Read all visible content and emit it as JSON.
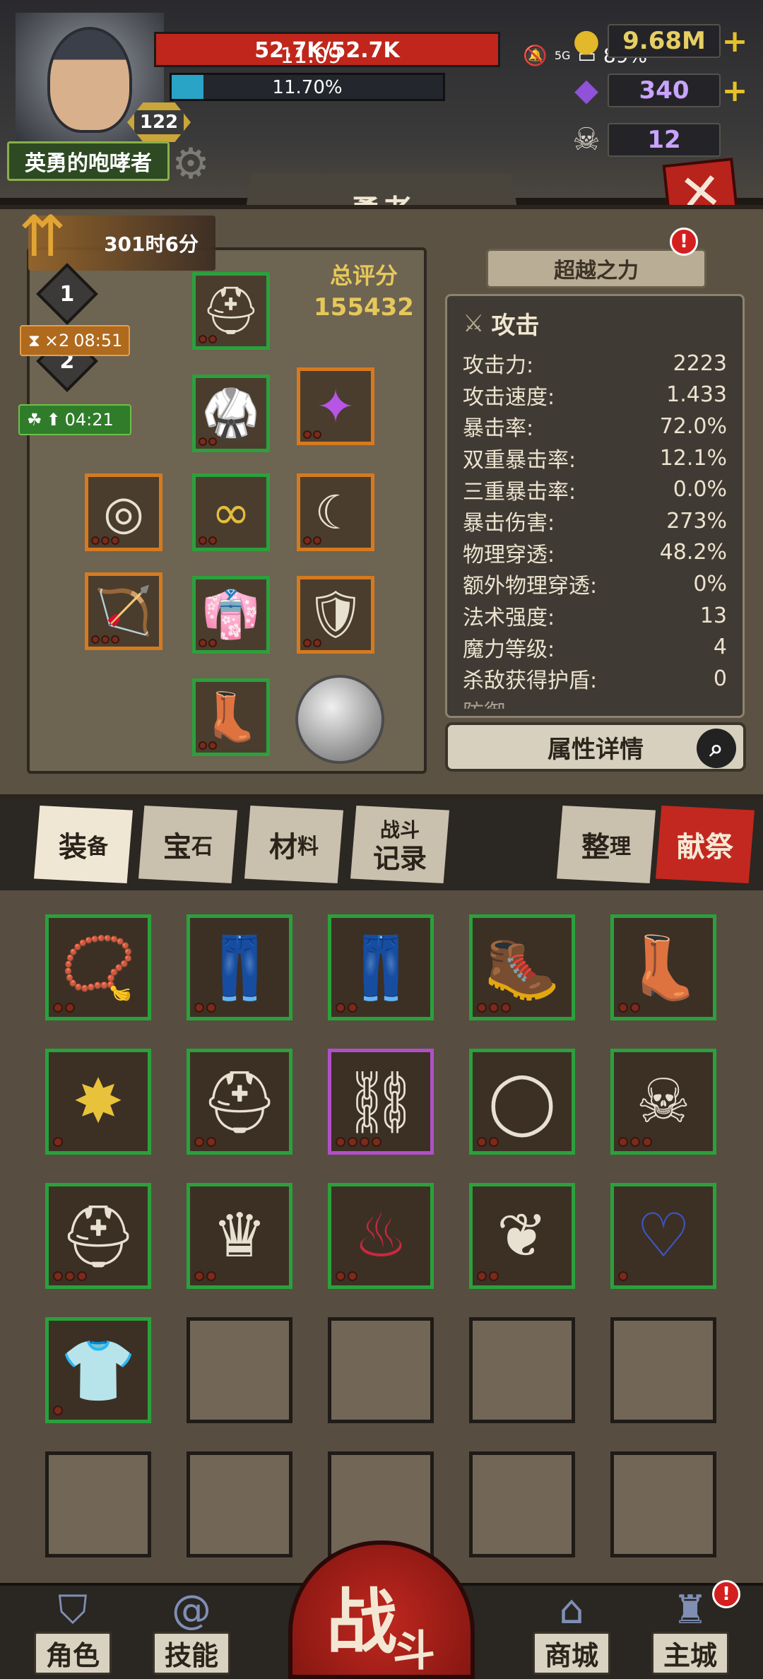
{
  "header": {
    "hp_text": "52.7K/52.7K",
    "clock": "11:09",
    "xp_text": "11.70%",
    "xp_progress": 0.117,
    "level": "122",
    "player_name": "英勇的咆哮者",
    "battery": "89%",
    "network": "5G"
  },
  "resources": {
    "gold": "9.68M",
    "gems": "340",
    "skulls": "12",
    "plus": "+"
  },
  "page": {
    "title": "勇者",
    "close": "✕"
  },
  "buffs": {
    "time_left": "301时6分",
    "stage_1": "1",
    "stage_2": "2",
    "speed_mult": "×2",
    "speed_time": "08:51",
    "luck_time": "04:21"
  },
  "equipment": {
    "score_label": "总评分",
    "score_value": "155432"
  },
  "transcend": {
    "label": "超越之力",
    "alert": "!"
  },
  "stats": {
    "header": "攻击",
    "rows": [
      {
        "label": "攻击力:",
        "value": "2223"
      },
      {
        "label": "攻击速度:",
        "value": "1.433"
      },
      {
        "label": "暴击率:",
        "value": "72.0%"
      },
      {
        "label": "双重暴击率:",
        "value": "12.1%"
      },
      {
        "label": "三重暴击率:",
        "value": "0.0%"
      },
      {
        "label": "暴击伤害:",
        "value": "273%"
      },
      {
        "label": "物理穿透:",
        "value": "48.2%"
      },
      {
        "label": "额外物理穿透:",
        "value": "0%"
      },
      {
        "label": "法术强度:",
        "value": "13"
      },
      {
        "label": "魔力等级:",
        "value": "4"
      },
      {
        "label": "杀敌获得护盾:",
        "value": "0"
      }
    ],
    "next_header": "防御",
    "detail_button": "属性详情"
  },
  "tabs": {
    "equip_main": "装",
    "equip_sub": "备",
    "gem_main": "宝",
    "gem_sub": "石",
    "material_main": "材",
    "material_sub": "料",
    "battle_log_1": "战斗",
    "battle_log_2": "记录",
    "sort_main": "整",
    "sort_sub": "理",
    "sacrifice": "献祭"
  },
  "bottom_nav": {
    "character": "角色",
    "skills": "技能",
    "battle_1": "战",
    "battle_2": "斗",
    "shop": "商城",
    "main_city": "主城",
    "alert": "!"
  },
  "colors": {
    "rarity_green": "#2aa13b",
    "rarity_orange": "#d67a1f",
    "rarity_purple": "#9a3cc9",
    "hp_red": "#c0261b",
    "xp_cyan": "#29a3c6",
    "gold_text": "#e6c85a"
  }
}
